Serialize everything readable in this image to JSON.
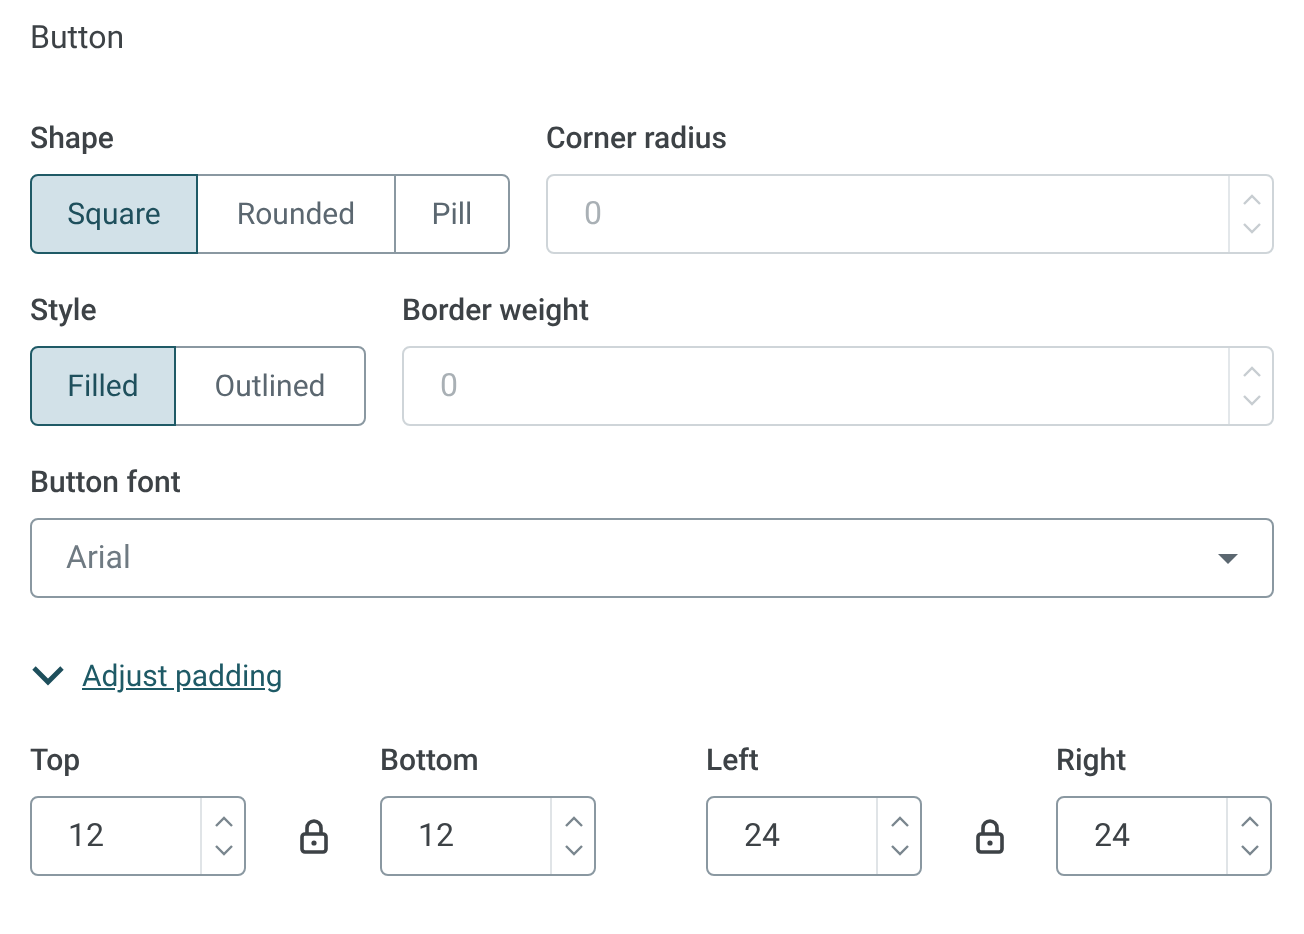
{
  "section_title": "Button",
  "shape": {
    "label": "Shape",
    "options": [
      {
        "label": "Square",
        "selected": true
      },
      {
        "label": "Rounded",
        "selected": false
      },
      {
        "label": "Pill",
        "selected": false
      }
    ]
  },
  "corner_radius": {
    "label": "Corner radius",
    "value": "0",
    "disabled": true
  },
  "style": {
    "label": "Style",
    "options": [
      {
        "label": "Filled",
        "selected": true
      },
      {
        "label": "Outlined",
        "selected": false
      }
    ]
  },
  "border_weight": {
    "label": "Border weight",
    "value": "0",
    "disabled": true
  },
  "button_font": {
    "label": "Button font",
    "value": "Arial"
  },
  "padding_toggle": {
    "label": "Adjust padding",
    "expanded": true
  },
  "padding_pairs": [
    {
      "locked": true,
      "fields": [
        {
          "label": "Top",
          "value": "12",
          "disabled": false
        },
        {
          "label": "Bottom",
          "value": "12",
          "disabled": false
        }
      ]
    },
    {
      "locked": true,
      "fields": [
        {
          "label": "Left",
          "value": "24",
          "disabled": false
        },
        {
          "label": "Right",
          "value": "24",
          "disabled": false
        }
      ]
    }
  ]
}
